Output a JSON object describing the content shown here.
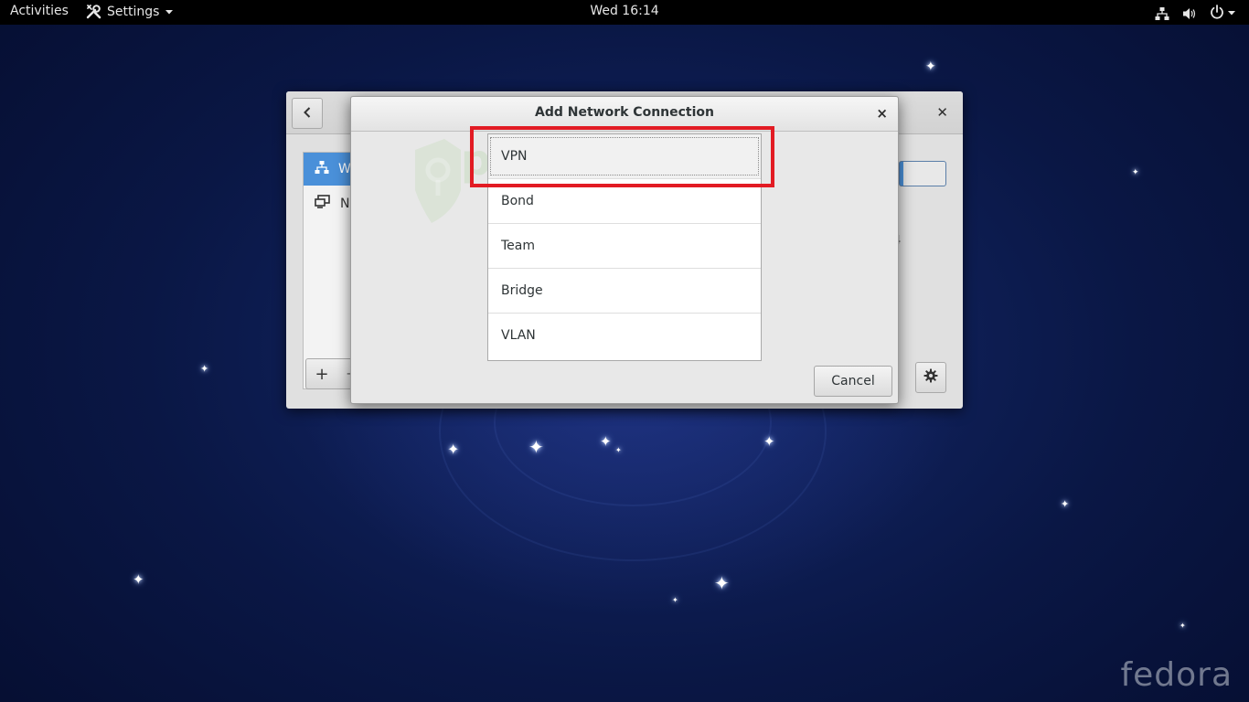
{
  "topbar": {
    "activities_label": "Activities",
    "app_menu_label": "Settings",
    "clock": "Wed 16:14"
  },
  "background_window": {
    "sidebar_items": [
      {
        "label": "W",
        "icon": "wired-network-icon",
        "selected": true
      },
      {
        "label": "N",
        "icon": "network-proxy-icon",
        "selected": false
      }
    ],
    "plus_label": "+",
    "minus_label": "-",
    "detail_fragment": "4"
  },
  "dialog": {
    "title": "Add Network Connection",
    "close_label": "×",
    "connection_types": [
      {
        "label": "VPN",
        "selected": true
      },
      {
        "label": "Bond",
        "selected": false
      },
      {
        "label": "Team",
        "selected": false
      },
      {
        "label": "Bridge",
        "selected": false
      },
      {
        "label": "VLAN",
        "selected": false
      }
    ],
    "cancel_label": "Cancel",
    "highlight_color": "#e21b23"
  },
  "watermark": {
    "text": "purevpn",
    "color": "#78be5a"
  },
  "desktop": {
    "logo_text": "fedora",
    "accent": "#4a90d9"
  }
}
